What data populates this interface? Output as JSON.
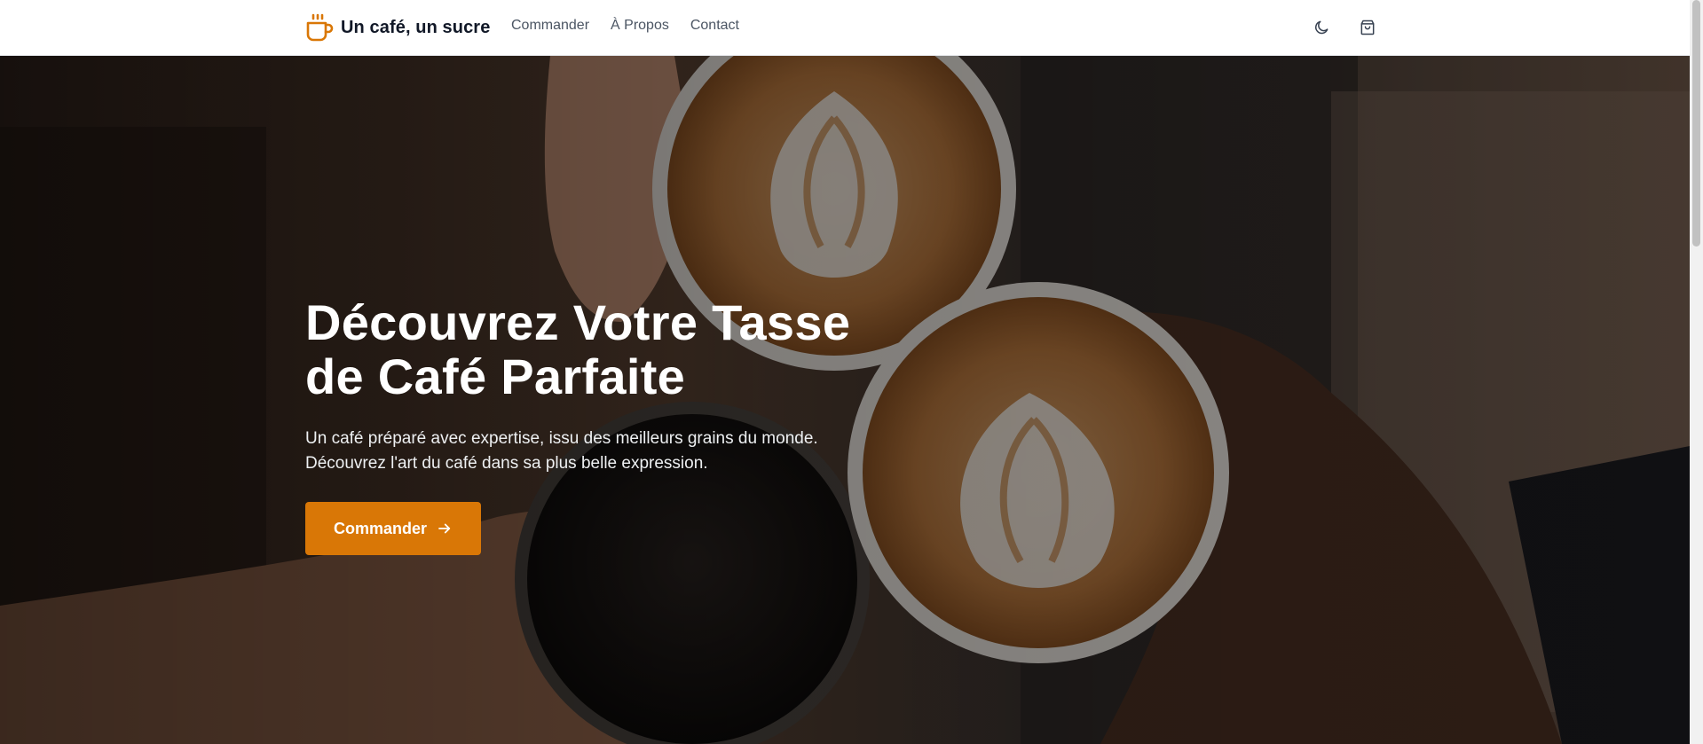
{
  "brand": {
    "name": "Un café, un sucre",
    "icon": "coffee-cup-icon",
    "accent_color": "#d97706"
  },
  "nav": {
    "links": [
      {
        "label": "Commander"
      },
      {
        "label": "À Propos"
      },
      {
        "label": "Contact"
      }
    ]
  },
  "actions": {
    "theme_toggle_icon": "moon-icon",
    "cart_icon": "shopping-bag-icon"
  },
  "hero": {
    "title_line1": "Découvrez Votre Tasse",
    "title_line2": "de Café Parfaite",
    "subtitle_line1": "Un café préparé avec expertise, issu des meilleurs grains du monde.",
    "subtitle_line2": "Découvrez l'art du café dans sa plus belle expression.",
    "cta_label": "Commander",
    "cta_icon": "arrow-right-icon",
    "background": "coffee-cups-cheers-photo"
  }
}
